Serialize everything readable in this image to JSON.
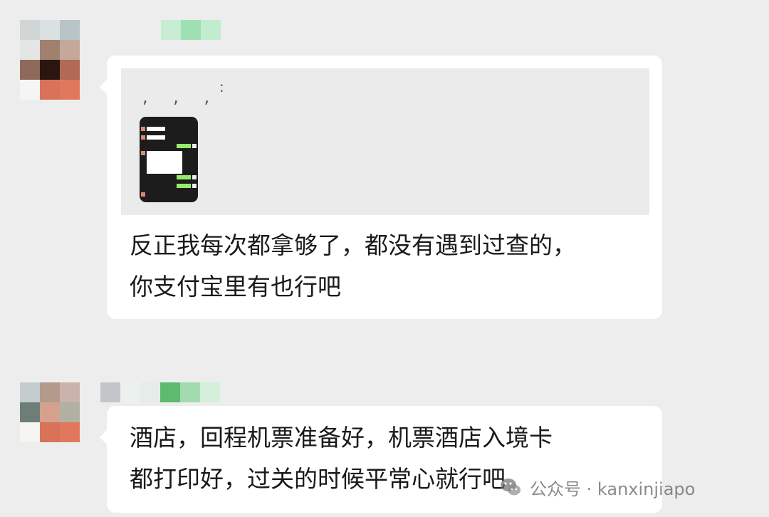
{
  "messages": [
    {
      "quote": {
        "punct": ", , ,",
        "colon": ":",
        "lines": [
          "反正我每次都拿够了，都没有遇到过查的，",
          "你支付宝里有也行吧"
        ]
      },
      "lines": [
        "反正我每次都拿够了，都没有遇到过查的，",
        "你支付宝里有也行吧"
      ]
    },
    {
      "lines": [
        "酒店，回程机票准备好，机票酒店入境卡",
        "都打印好，过关的时候平常心就行吧"
      ]
    }
  ],
  "watermark": {
    "label": "公众号 · kanxinjiapo"
  },
  "colors": {
    "background": "#ededed",
    "bubble": "#ffffff",
    "quote_bg": "#ebebeb",
    "sent_green": "#95ec69"
  },
  "icons": [
    "avatar-mosaic",
    "wechat-logo-icon"
  ]
}
